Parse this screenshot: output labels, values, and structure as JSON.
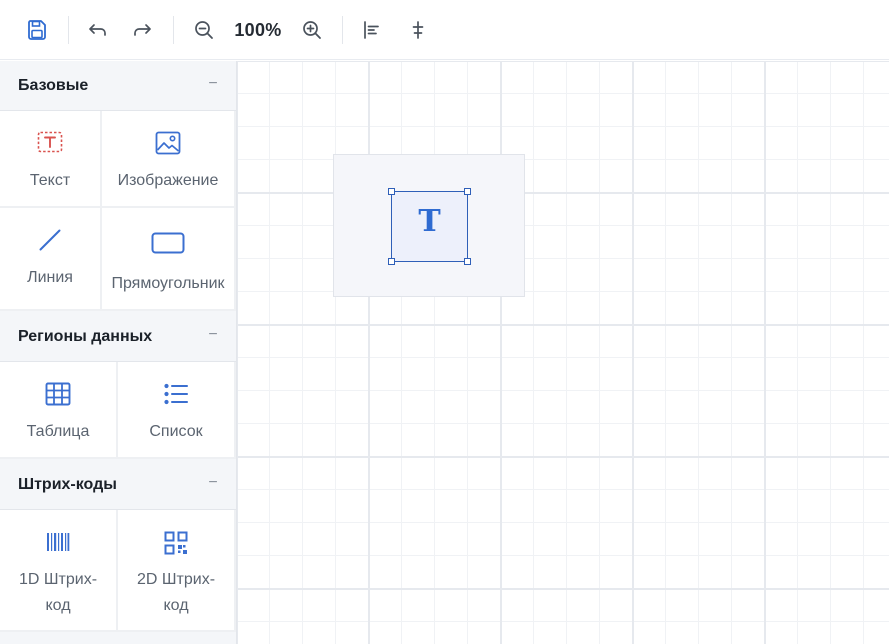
{
  "toolbar": {
    "buttons": [
      {
        "name": "save",
        "icon": "save-icon"
      },
      {
        "name": "undo",
        "icon": "undo-icon"
      },
      {
        "name": "redo",
        "icon": "redo-icon"
      },
      {
        "name": "zoom-out",
        "icon": "zoom-out-icon"
      },
      {
        "name": "zoom-in",
        "icon": "zoom-in-icon"
      },
      {
        "name": "align-left",
        "icon": "align-left-icon"
      },
      {
        "name": "align-center",
        "icon": "align-center-vertical-icon"
      }
    ],
    "zoom_label": "100%"
  },
  "sidebar": {
    "sections": [
      {
        "title": "Базовые",
        "toggle": "−",
        "items": [
          {
            "label": "Текст",
            "icon": "text-box-icon"
          },
          {
            "label": "Изображение",
            "icon": "image-icon"
          },
          {
            "label": "Линия",
            "icon": "line-icon"
          },
          {
            "label": "Прямоугольник",
            "icon": "rectangle-icon"
          }
        ]
      },
      {
        "title": "Регионы данных",
        "toggle": "−",
        "items": [
          {
            "label": "Таблица",
            "icon": "table-icon"
          },
          {
            "label": "Список",
            "icon": "list-icon"
          }
        ]
      },
      {
        "title": "Штрих-коды",
        "toggle": "−",
        "items": [
          {
            "label": "1D Штрих-код",
            "label_lines": [
              "1D Штрих-",
              "код"
            ],
            "icon": "barcode-icon"
          },
          {
            "label": "2D Штрих-код",
            "label_lines": [
              "2D Штрих-",
              "код"
            ],
            "icon": "qr-code-icon"
          }
        ]
      }
    ]
  },
  "canvas": {
    "selected_element": {
      "type": "text",
      "glyph": "T"
    }
  },
  "colors": {
    "accent": "#2f6bd1",
    "icon_blue": "#3b6fd0",
    "text_icon_red": "#d9534f",
    "sidebar_bg": "#f4f6f9",
    "grid_major": "#e6e9ee",
    "grid_minor": "#f0f2f5"
  }
}
